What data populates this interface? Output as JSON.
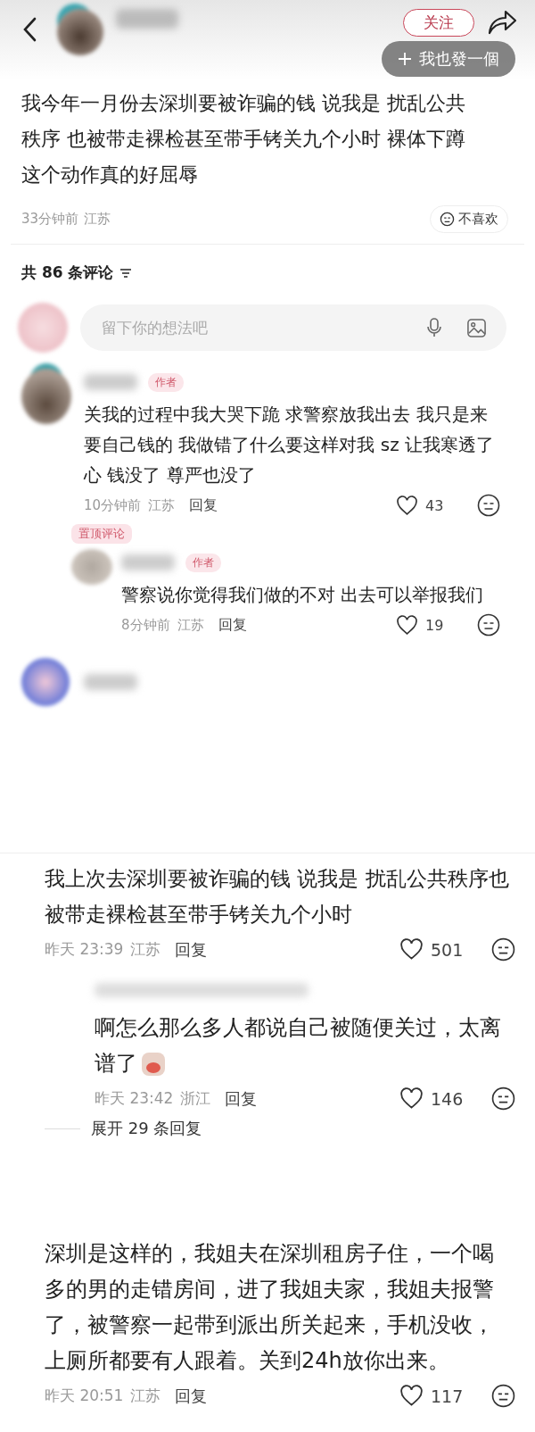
{
  "header": {
    "follow_button": "关注",
    "overlay_button": "我也發一個"
  },
  "post": {
    "text": "我今年一月份去深圳要被诈骗的钱 说我是 扰乱公共秩序  也被带走裸检甚至带手铐关九个小时 裸体下蹲这个动作真的好屈辱",
    "time": "33分钟前",
    "location": "江苏",
    "dislike": "不喜欢"
  },
  "comment_count": "共 86 条评论",
  "comment_input": {
    "placeholder": "留下你的想法吧"
  },
  "comments": [
    {
      "author_tag": "作者",
      "text": "关我的过程中我大哭下跪 求警察放我出去 我只是来要自己钱的 我做错了什么要这样对我 sz 让我寒透了心 钱没了 尊严也没了",
      "time": "10分钟前",
      "location": "江苏",
      "reply": "回复",
      "likes": "43",
      "replies": [
        {
          "pinned_label": "置顶评论",
          "author_tag": "作者",
          "text": "警察说你觉得我们做的不对 出去可以举报我们",
          "time": "8分钟前",
          "location": "江苏",
          "reply": "回复",
          "likes": "19"
        }
      ]
    }
  ],
  "second_screenshot": {
    "comments": [
      {
        "text": "我上次去深圳要被诈骗的钱 说我是 扰乱公共秩序也被带走裸检甚至带手铐关九个小时",
        "time": "昨天 23:39",
        "location": "江苏",
        "reply": "回复",
        "likes": "501",
        "replies": [
          {
            "text": "啊怎么那么多人都说自己被随便关过，太离谱了",
            "has_sticker": true,
            "time": "昨天 23:42",
            "location": "浙江",
            "reply": "回复",
            "likes": "146"
          }
        ],
        "expand_label": "展开 29 条回复"
      },
      {
        "text": "深圳是这样的，我姐夫在深圳租房子住，一个喝多的男的走错房间，进了我姐夫家，我姐夫报警了，被警察一起带到派出所关起来，手机没收，上厕所都要有人跟着。关到24h放你出来。",
        "time": "昨天 20:51",
        "location": "江苏",
        "reply": "回复",
        "likes": "117"
      }
    ]
  }
}
